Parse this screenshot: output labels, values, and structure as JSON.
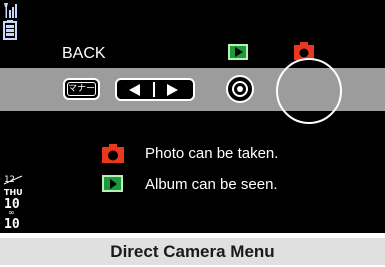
{
  "status": {
    "icons": [
      "antenna-icon",
      "battery-icon"
    ],
    "calendar": {
      "month": "12",
      "day_of_week": "THU",
      "date": "10",
      "time_hour": "10",
      "time_minute": "10"
    }
  },
  "header": {
    "back_label": "BACK",
    "modes": [
      {
        "name": "album-mode-icon",
        "color": "#1a9a3a"
      },
      {
        "name": "camera-mode-icon",
        "color": "#e8381e"
      }
    ]
  },
  "controls": {
    "manner_label": "マナー",
    "buttons": [
      "manner-button",
      "nav-left-button",
      "nav-right-button",
      "center-key",
      "shutter-ring"
    ]
  },
  "legend": [
    {
      "icon": "camera-icon",
      "text": "Photo can be taken."
    },
    {
      "icon": "album-icon",
      "text": "Album can be seen."
    }
  ],
  "caption": "Direct Camera Menu",
  "colors": {
    "camera_red": "#e8381e",
    "album_green": "#1a9a3a",
    "bar_gray": "#9c9c9c",
    "caption_bg": "#e0e0e0"
  }
}
